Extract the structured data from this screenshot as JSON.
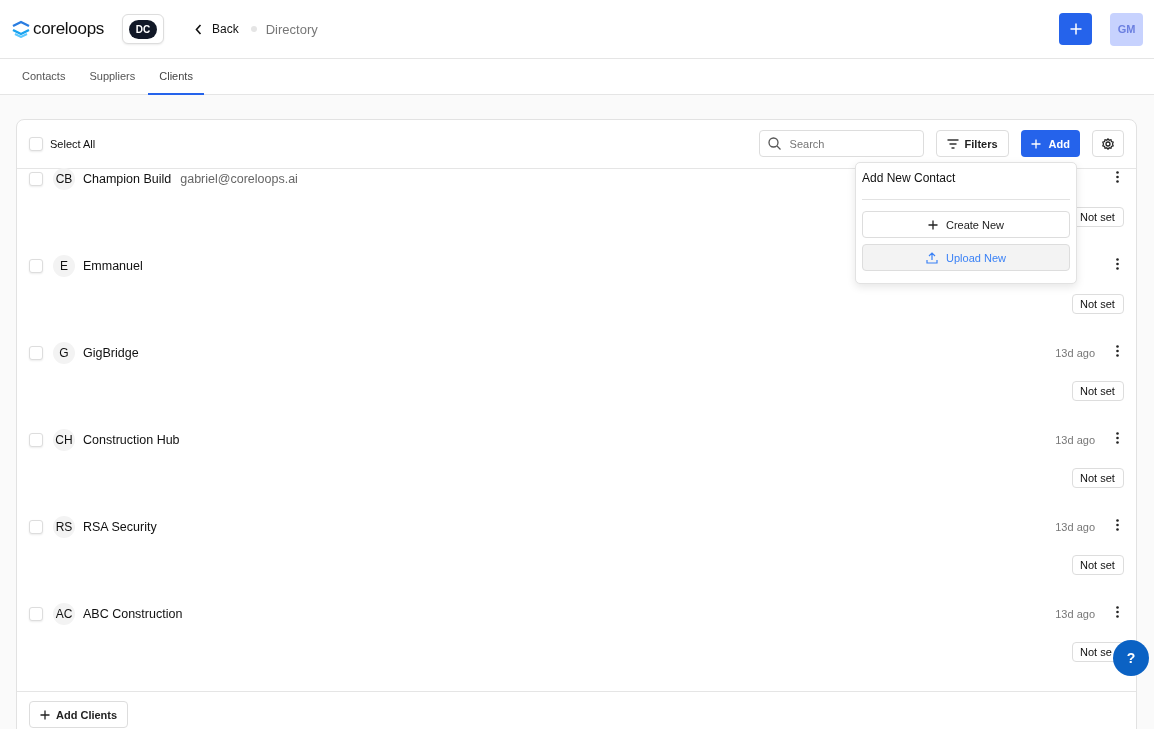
{
  "header": {
    "logo": "coreloops",
    "workspace": "DC",
    "back": "Back",
    "breadcrumb": "Directory",
    "user": "GM"
  },
  "tabs": [
    {
      "label": "Contacts",
      "selected": false
    },
    {
      "label": "Suppliers",
      "selected": false
    },
    {
      "label": "Clients",
      "selected": true
    }
  ],
  "toolbar": {
    "select_all": "Select All",
    "select_all_checked": false,
    "search_placeholder": "Search",
    "filters": "Filters",
    "add": "Add"
  },
  "rows": [
    {
      "initials": "CB",
      "name": "Champion Build",
      "email": "gabriel@coreloops.ai",
      "checked": false,
      "status": "Not set"
    },
    {
      "initials": "E",
      "name": "Emmanuel",
      "checked": false,
      "status": "Not set"
    },
    {
      "initials": "G",
      "name": "GigBridge",
      "checked": false,
      "time": "13d ago",
      "status": "Not set"
    },
    {
      "initials": "CH",
      "name": "Construction Hub",
      "checked": false,
      "time": "13d ago",
      "status": "Not set"
    },
    {
      "initials": "RS",
      "name": "RSA Security",
      "checked": false,
      "time": "13d ago",
      "status": "Not set"
    },
    {
      "initials": "AC",
      "name": "ABC Construction",
      "checked": false,
      "time": "13d ago",
      "status": "Not se"
    }
  ],
  "footer": {
    "add_button": "Add Clients"
  },
  "add_menu": {
    "title": "Add New Contact",
    "items": [
      {
        "label": "Create New",
        "kind": "create",
        "selected": false
      },
      {
        "label": "Upload New",
        "kind": "upload",
        "selected": true
      }
    ]
  },
  "help": "?"
}
